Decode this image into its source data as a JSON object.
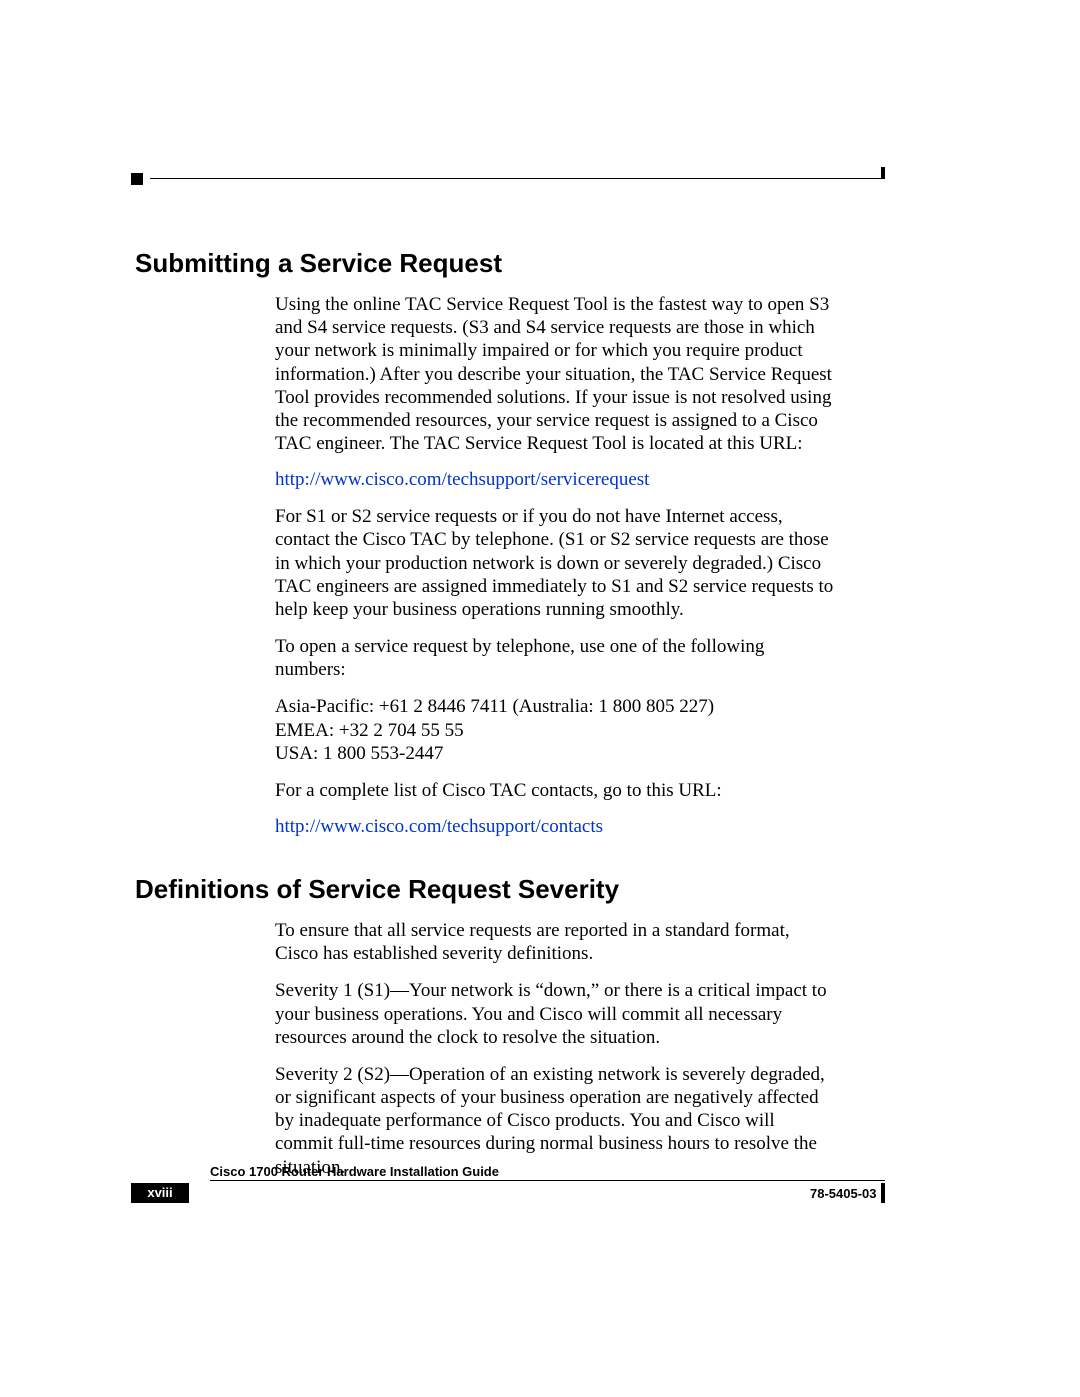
{
  "section1": {
    "heading": "Submitting a Service Request",
    "p1": "Using the online TAC Service Request Tool is the fastest way to open S3 and S4 service requests. (S3 and S4 service requests are those in which your network is minimally impaired or for which you require product information.) After you describe your situation, the TAC Service Request Tool provides recommended solutions. If your issue is not resolved using the recommended resources, your service request is assigned to a Cisco TAC engineer. The TAC Service Request Tool is located at this URL:",
    "link1": "http://www.cisco.com/techsupport/servicerequest",
    "p2": "For S1 or S2 service requests or if you do not have Internet access, contact the Cisco TAC by telephone. (S1 or S2 service requests are those in which your production network is down or severely degraded.) Cisco TAC engineers are assigned immediately to S1 and S2 service requests to help keep your business operations running smoothly.",
    "p3": "To open a service request by telephone, use one of the following numbers:",
    "phone_ap": "Asia-Pacific: +61 2 8446 7411 (Australia: 1 800 805 227)",
    "phone_emea": "EMEA: +32 2 704 55 55",
    "phone_usa": "USA: 1 800 553-2447",
    "p4": "For a complete list of Cisco TAC contacts, go to this URL:",
    "link2": "http://www.cisco.com/techsupport/contacts"
  },
  "section2": {
    "heading": "Definitions of Service Request Severity",
    "p1": "To ensure that all service requests are reported in a standard format, Cisco has established severity definitions.",
    "p2": "Severity 1 (S1)—Your network is “down,” or there is a critical impact to your business operations. You and Cisco will commit all necessary resources around the clock to resolve the situation.",
    "p3": "Severity 2 (S2)—Operation of an existing network is severely degraded, or significant aspects of your business operation are negatively affected by inadequate performance of Cisco products. You and Cisco will commit full-time resources during normal business hours to resolve the situation."
  },
  "footer": {
    "title": "Cisco 1700 Router Hardware Installation Guide",
    "page": "xviii",
    "docnum": "78-5405-03"
  }
}
